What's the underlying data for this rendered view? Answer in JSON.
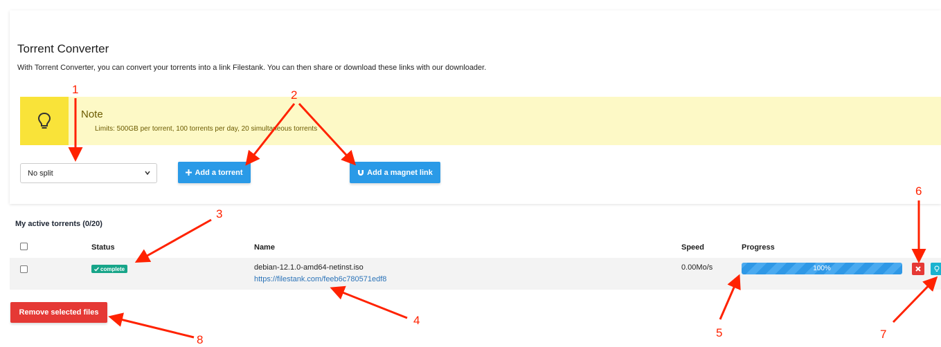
{
  "header": {
    "title": "Torrent Converter",
    "subtitle": "With Torrent Converter, you can convert your torrents into a link Filestank. You can then share or download these links with our downloader."
  },
  "note": {
    "title": "Note",
    "text": "Limits: 500GB per torrent, 100 torrents per day, 20 simultaneous torrents"
  },
  "controls": {
    "split_value": "No split",
    "add_torrent_label": "Add a torrent",
    "add_magnet_label": "Add a magnet link"
  },
  "torrents": {
    "section_title": "My active torrents (0/20)",
    "columns": {
      "status": "Status",
      "name": "Name",
      "speed": "Speed",
      "progress": "Progress"
    },
    "rows": [
      {
        "status": "complete",
        "name": "debian-12.1.0-amd64-netinst.iso",
        "link": "https://filestank.com/feeb6c780571edf8",
        "speed": "0.00Mo/s",
        "progress_label": "100%",
        "progress_value": 1.0
      }
    ],
    "remove_label": "Remove selected files"
  },
  "annotations": [
    "1",
    "2",
    "3",
    "4",
    "5",
    "6",
    "7",
    "8"
  ],
  "colors": {
    "primary": "#2a9ae7",
    "danger": "#e53935",
    "success": "#17a589",
    "info": "#1bb3d0",
    "note_bg": "#fdf9c6",
    "note_icon_bg": "#f9e339",
    "annotation": "#ff2200"
  },
  "icons": {
    "note": "lightbulb-icon",
    "add_torrent": "plus-icon",
    "add_magnet": "magnet-icon",
    "complete": "check-icon",
    "delete": "close-icon",
    "info": "lightbulb-icon"
  }
}
